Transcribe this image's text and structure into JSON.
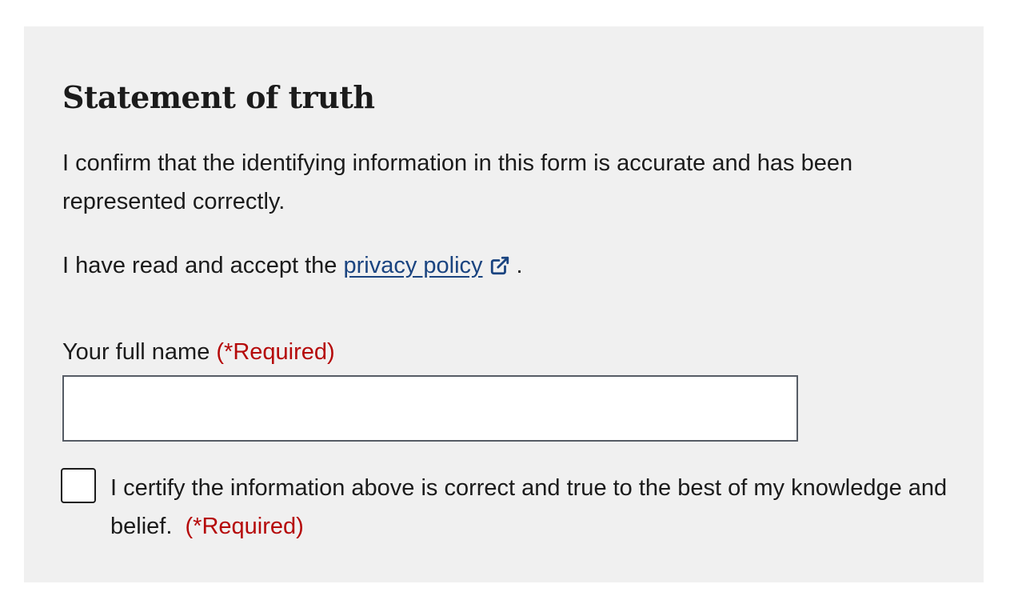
{
  "section": {
    "title": "Statement of truth",
    "confirm_text": "I confirm that the identifying information in this form is accurate and has been represented correctly.",
    "privacy_prefix": "I have read and accept the ",
    "privacy_link": "privacy policy",
    "privacy_suffix": ".",
    "link_icon": "external-link-icon"
  },
  "name_field": {
    "label": "Your full name",
    "required": "(*Required)",
    "value": "",
    "placeholder": ""
  },
  "certify": {
    "checked": false,
    "label": "I certify the information above is correct and true to the best of my knowledge and belief.",
    "required": "(*Required)"
  },
  "colors": {
    "panel_bg": "#f0f0f0",
    "link": "#1a4480",
    "required": "#b50909"
  }
}
